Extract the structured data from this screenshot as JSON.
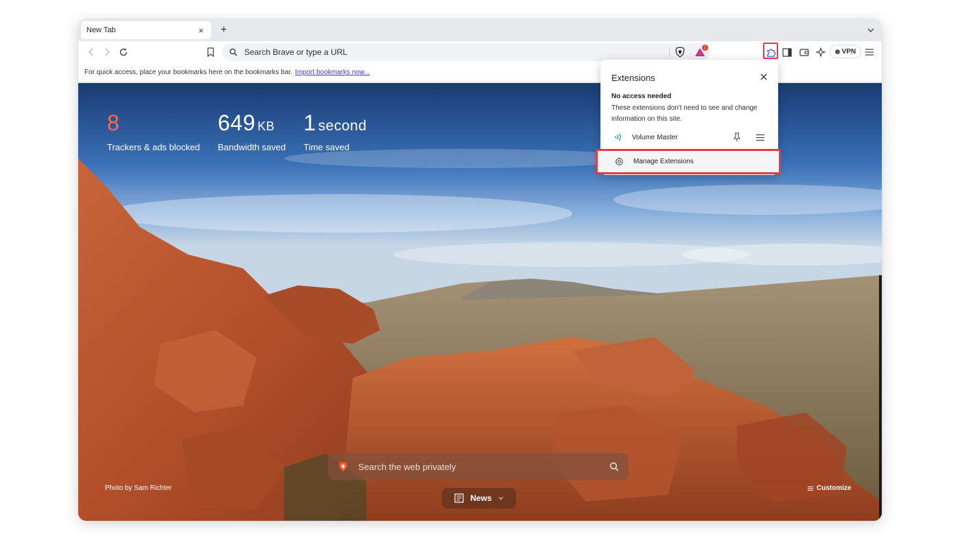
{
  "tab": {
    "title": "New Tab",
    "close_glyph": "×",
    "new_tab_glyph": "+"
  },
  "omnibox": {
    "placeholder": "Search Brave or type a URL"
  },
  "toolbar": {
    "vpn_label": "VPN",
    "rewards_badge": "1"
  },
  "bookmarks_bar": {
    "message": "For quick access, place your bookmarks here on the bookmarks bar.",
    "import_link": "Import bookmarks now..."
  },
  "stats": {
    "trackers": {
      "value": "8",
      "label": "Trackers & ads blocked"
    },
    "bandwidth": {
      "value": "649",
      "unit": "KB",
      "label": "Bandwidth saved"
    },
    "time": {
      "value": "1",
      "unit": "second",
      "label": "Time saved"
    }
  },
  "ntp": {
    "search_placeholder": "Search the web privately",
    "news_label": "News",
    "photo_credit": "Photo by Sam Richter",
    "customize_label": "Customize"
  },
  "extensions_popup": {
    "title": "Extensions",
    "section_title": "No access needed",
    "section_desc": "These extensions don't need to see and change information on this site.",
    "items": [
      {
        "name": "Volume Master"
      }
    ],
    "manage_label": "Manage Extensions"
  },
  "colors": {
    "accent_highlight": "#e23b48",
    "trackers_value": "#fb6b4b",
    "brave_orange": "#fb542b"
  }
}
